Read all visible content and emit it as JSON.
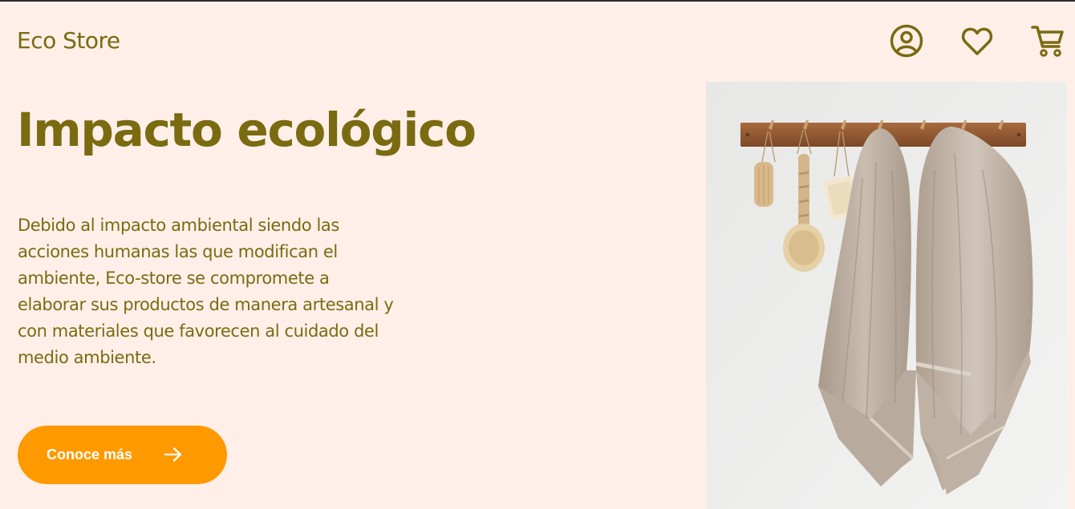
{
  "header": {
    "brand": "Eco Store",
    "icons": [
      "user-icon",
      "heart-icon",
      "cart-icon"
    ]
  },
  "hero": {
    "title": "Impacto ecológico",
    "description": "Debido al impacto ambiental siendo las acciones humanas las que modifican el ambiente, Eco-store se compromete a elaborar sus productos de manera artesanal y con materiales que favorecen al cuidado del medio ambiente.",
    "cta_label": "Conoce más",
    "cta_icon": "arrow-right-icon"
  },
  "colors": {
    "background": "#FFEFE8",
    "primary_text": "#7A6A10",
    "cta_background": "#FF9900",
    "cta_text": "#FFFFFF"
  }
}
